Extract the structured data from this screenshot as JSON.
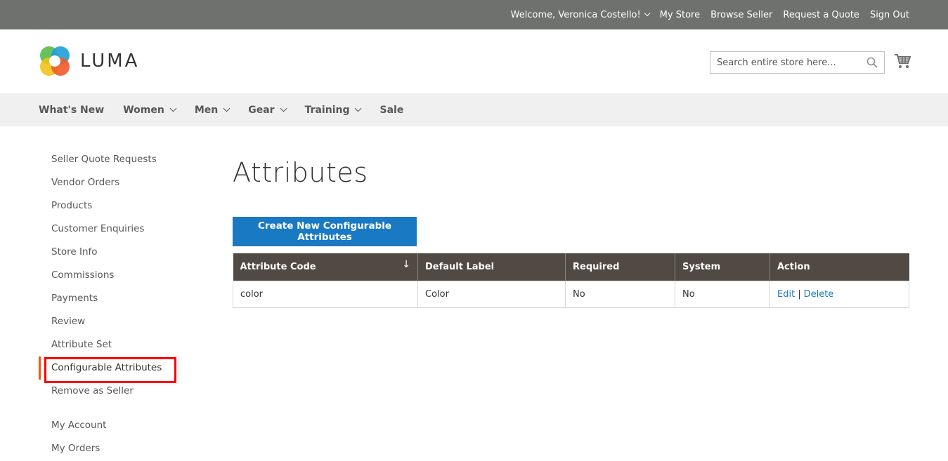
{
  "topbar": {
    "welcome": "Welcome, Veronica Costello!",
    "links": [
      "My Store",
      "Browse Seller",
      "Request a Quote",
      "Sign Out"
    ]
  },
  "header": {
    "logo_text": "LUMA",
    "search_placeholder": "Search entire store here...",
    "icons": [
      "search-icon",
      "cart-icon"
    ]
  },
  "nav": {
    "items": [
      {
        "label": "What's New",
        "has_dropdown": false
      },
      {
        "label": "Women",
        "has_dropdown": true
      },
      {
        "label": "Men",
        "has_dropdown": true
      },
      {
        "label": "Gear",
        "has_dropdown": true
      },
      {
        "label": "Training",
        "has_dropdown": true
      },
      {
        "label": "Sale",
        "has_dropdown": false
      }
    ]
  },
  "sidebar": {
    "items": [
      "Seller Quote Requests",
      "Vendor Orders",
      "Products",
      "Customer Enquiries",
      "Store Info",
      "Commissions",
      "Payments",
      "Review",
      "Attribute Set",
      "Configurable Attributes",
      "Remove as Seller"
    ],
    "active": "Configurable Attributes",
    "account_items": [
      "My Account",
      "My Orders"
    ],
    "accent_color": "#ff5501",
    "highlight_color": "#ff0000"
  },
  "main": {
    "title": "Attributes",
    "create_button": "Create New Configurable Attributes",
    "table": {
      "columns": [
        "Attribute Code",
        "Default Label",
        "Required",
        "System",
        "Action"
      ],
      "sort_indicator": "↓",
      "rows": [
        {
          "code": "color",
          "label": "Color",
          "required": "No",
          "system": "No",
          "edit": "Edit",
          "sep": "|",
          "delete": "Delete"
        }
      ]
    },
    "colors": {
      "button": "#1979c3",
      "table_header": "#514943",
      "link": "#1979c3"
    }
  }
}
